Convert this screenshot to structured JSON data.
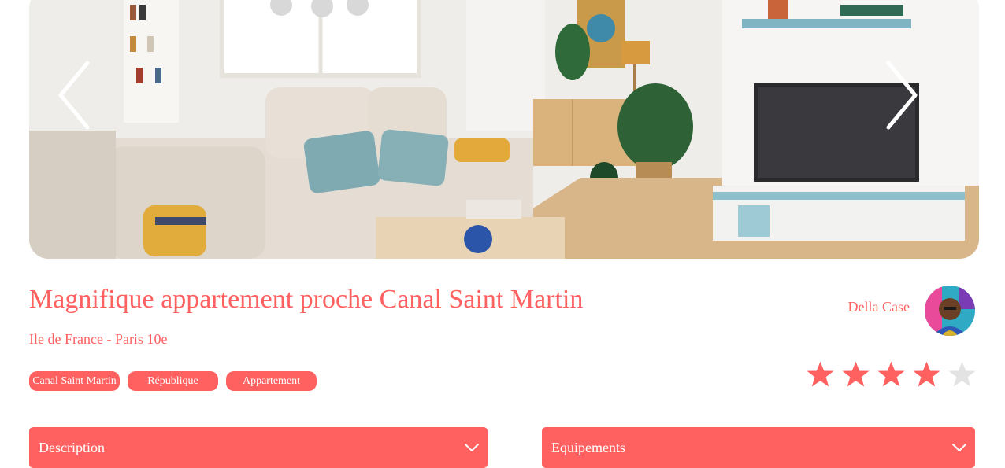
{
  "carousel": {
    "prev_icon": "chevron-left-icon",
    "next_icon": "chevron-right-icon"
  },
  "listing": {
    "title": "Magnifique appartement proche Canal Saint Martin",
    "location": "Ile de France - Paris 10e",
    "tags": [
      "Canal Saint Martin",
      "République",
      "Appartement"
    ],
    "rating": 4,
    "rating_max": 5
  },
  "host": {
    "name": "Della Case"
  },
  "collapses": {
    "description_label": "Description",
    "equipements_label": "Equipements",
    "icon": "chevron-down-icon"
  },
  "colors": {
    "accent": "#ff6060",
    "star_inactive": "#e3e3e3",
    "text_on_accent": "#ffffff"
  }
}
